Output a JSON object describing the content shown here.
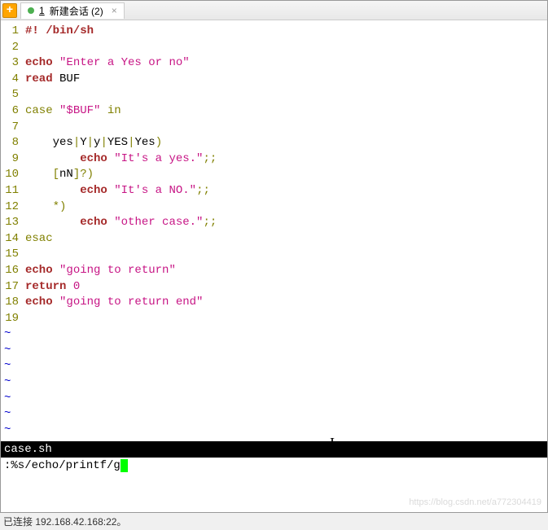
{
  "tab": {
    "number": "1",
    "title": "新建会话 (2)",
    "close": "×",
    "newtab": "+"
  },
  "code": {
    "lines": [
      {
        "n": "1",
        "segs": [
          {
            "t": "#! /bin/sh",
            "c": "cmd"
          }
        ]
      },
      {
        "n": "2",
        "segs": []
      },
      {
        "n": "3",
        "segs": [
          {
            "t": "echo",
            "c": "cmd"
          },
          {
            "t": " ",
            "c": ""
          },
          {
            "t": "\"Enter a Yes or no\"",
            "c": "str"
          }
        ]
      },
      {
        "n": "4",
        "segs": [
          {
            "t": "read",
            "c": "cmd"
          },
          {
            "t": " BUF",
            "c": "idn"
          }
        ]
      },
      {
        "n": "5",
        "segs": []
      },
      {
        "n": "6",
        "segs": [
          {
            "t": "case",
            "c": "kw"
          },
          {
            "t": " ",
            "c": ""
          },
          {
            "t": "\"$BUF\"",
            "c": "str"
          },
          {
            "t": " ",
            "c": ""
          },
          {
            "t": "in",
            "c": "kw"
          }
        ]
      },
      {
        "n": "7",
        "segs": []
      },
      {
        "n": "8",
        "segs": [
          {
            "t": "    yes",
            "c": "idn"
          },
          {
            "t": "|",
            "c": "op"
          },
          {
            "t": "Y",
            "c": "idn"
          },
          {
            "t": "|",
            "c": "op"
          },
          {
            "t": "y",
            "c": "idn"
          },
          {
            "t": "|",
            "c": "op"
          },
          {
            "t": "YES",
            "c": "idn"
          },
          {
            "t": "|",
            "c": "op"
          },
          {
            "t": "Yes",
            "c": "idn"
          },
          {
            "t": ")",
            "c": "op"
          }
        ]
      },
      {
        "n": "9",
        "segs": [
          {
            "t": "        ",
            "c": ""
          },
          {
            "t": "echo",
            "c": "cmd"
          },
          {
            "t": " ",
            "c": ""
          },
          {
            "t": "\"It's a yes.\"",
            "c": "str"
          },
          {
            "t": ";;",
            "c": "op"
          }
        ]
      },
      {
        "n": "10",
        "segs": [
          {
            "t": "    ",
            "c": ""
          },
          {
            "t": "[",
            "c": "op"
          },
          {
            "t": "nN",
            "c": "idn"
          },
          {
            "t": "]?)",
            "c": "op"
          }
        ]
      },
      {
        "n": "11",
        "segs": [
          {
            "t": "        ",
            "c": ""
          },
          {
            "t": "echo",
            "c": "cmd"
          },
          {
            "t": " ",
            "c": ""
          },
          {
            "t": "\"It's a NO.\"",
            "c": "str"
          },
          {
            "t": ";;",
            "c": "op"
          }
        ]
      },
      {
        "n": "12",
        "segs": [
          {
            "t": "    ",
            "c": ""
          },
          {
            "t": "*)",
            "c": "op"
          }
        ]
      },
      {
        "n": "13",
        "segs": [
          {
            "t": "        ",
            "c": ""
          },
          {
            "t": "echo",
            "c": "cmd"
          },
          {
            "t": " ",
            "c": ""
          },
          {
            "t": "\"other case.\"",
            "c": "str"
          },
          {
            "t": ";;",
            "c": "op"
          }
        ]
      },
      {
        "n": "14",
        "segs": [
          {
            "t": "esac",
            "c": "kw"
          }
        ]
      },
      {
        "n": "15",
        "segs": []
      },
      {
        "n": "16",
        "segs": [
          {
            "t": "echo",
            "c": "cmd"
          },
          {
            "t": " ",
            "c": ""
          },
          {
            "t": "\"going to return\"",
            "c": "str"
          }
        ]
      },
      {
        "n": "17",
        "segs": [
          {
            "t": "return",
            "c": "cmd"
          },
          {
            "t": " ",
            "c": ""
          },
          {
            "t": "0",
            "c": "str"
          }
        ]
      },
      {
        "n": "18",
        "segs": [
          {
            "t": "echo",
            "c": "cmd"
          },
          {
            "t": " ",
            "c": ""
          },
          {
            "t": "\"going to return end\"",
            "c": "str"
          }
        ]
      },
      {
        "n": "19",
        "segs": []
      }
    ],
    "tilde_count": 7
  },
  "filename": "case.sh",
  "vim_command": ":%s/echo/printf/g",
  "status": "已连接 192.168.42.168:22。",
  "tilde": "~",
  "watermark": "https://blog.csdn.net/a772304419"
}
